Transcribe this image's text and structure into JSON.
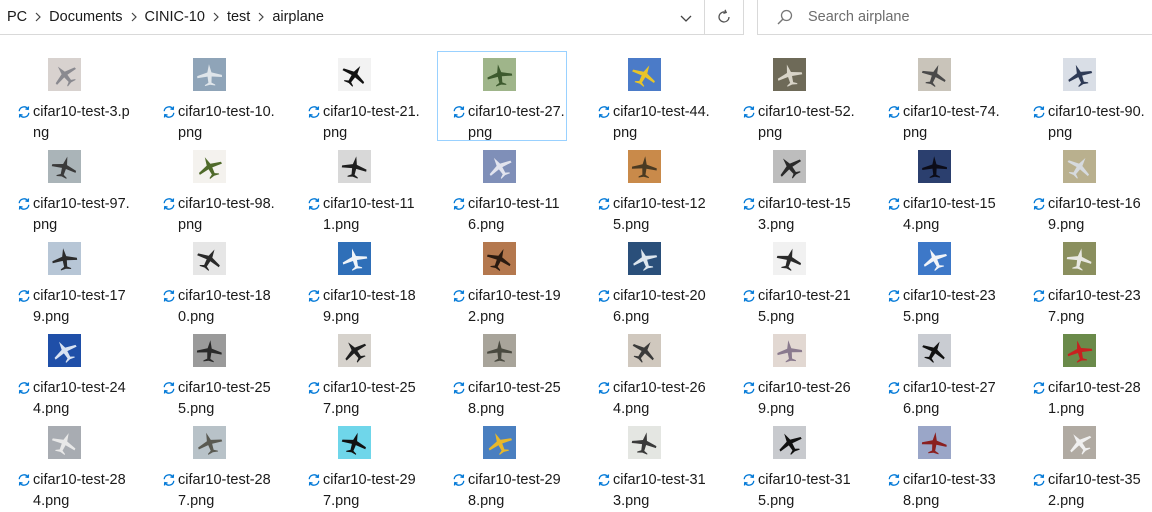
{
  "breadcrumb": [
    "PC",
    "Documents",
    "CINIC-10",
    "test",
    "airplane"
  ],
  "search": {
    "placeholder": "Search airplane"
  },
  "colors": {
    "accent": "#0078d7",
    "selection_border": "#99d1ff",
    "border": "#d9d9d9"
  },
  "files": [
    {
      "line1": "cifar10-test-3.p",
      "line2": "ng",
      "bg": "#d8d2cf",
      "fg": "#8a8a90",
      "selected": false
    },
    {
      "line1": "cifar10-test-10.",
      "line2": "png",
      "bg": "#8fa4b8",
      "fg": "#dfe5ea",
      "selected": false
    },
    {
      "line1": "cifar10-test-21.",
      "line2": "png",
      "bg": "#f2f2f2",
      "fg": "#111111",
      "selected": false
    },
    {
      "line1": "cifar10-test-27.",
      "line2": "png",
      "bg": "#9fb58a",
      "fg": "#3d5a2e",
      "selected": true
    },
    {
      "line1": "cifar10-test-44.",
      "line2": "png",
      "bg": "#4b7bc8",
      "fg": "#e8c428",
      "selected": false
    },
    {
      "line1": "cifar10-test-52.",
      "line2": "png",
      "bg": "#6e6a58",
      "fg": "#d8d4c8",
      "selected": false
    },
    {
      "line1": "cifar10-test-74.",
      "line2": "png",
      "bg": "#c9c4ba",
      "fg": "#4a4a4a",
      "selected": false
    },
    {
      "line1": "cifar10-test-90.",
      "line2": "png",
      "bg": "#d9dee6",
      "fg": "#2e3a55",
      "selected": false
    },
    {
      "line1": "cifar10-test-97.",
      "line2": "png",
      "bg": "#aab4b8",
      "fg": "#3a3a3a",
      "selected": false
    },
    {
      "line1": "cifar10-test-98.",
      "line2": "png",
      "bg": "#f4f2ee",
      "fg": "#4f6a2a",
      "selected": false
    },
    {
      "line1": "cifar10-test-11",
      "line2": "1.png",
      "bg": "#d8d8d8",
      "fg": "#1e1e1e",
      "selected": false
    },
    {
      "line1": "cifar10-test-11",
      "line2": "6.png",
      "bg": "#7f8fb8",
      "fg": "#e2e4ee",
      "selected": false
    },
    {
      "line1": "cifar10-test-12",
      "line2": "5.png",
      "bg": "#c98a4a",
      "fg": "#4a3a22",
      "selected": false
    },
    {
      "line1": "cifar10-test-15",
      "line2": "3.png",
      "bg": "#bdbdbd",
      "fg": "#2a2a2a",
      "selected": false
    },
    {
      "line1": "cifar10-test-15",
      "line2": "4.png",
      "bg": "#2b3f6e",
      "fg": "#0c0c18",
      "selected": false
    },
    {
      "line1": "cifar10-test-16",
      "line2": "9.png",
      "bg": "#b9b08e",
      "fg": "#d6dade",
      "selected": false
    },
    {
      "line1": "cifar10-test-17",
      "line2": "9.png",
      "bg": "#b7c6d6",
      "fg": "#2c2c2c",
      "selected": false
    },
    {
      "line1": "cifar10-test-18",
      "line2": "0.png",
      "bg": "#e6e6e6",
      "fg": "#2a2a2a",
      "selected": false
    },
    {
      "line1": "cifar10-test-18",
      "line2": "9.png",
      "bg": "#2f6fb8",
      "fg": "#f0f4f8",
      "selected": false
    },
    {
      "line1": "cifar10-test-19",
      "line2": "2.png",
      "bg": "#b4784e",
      "fg": "#2a1a10",
      "selected": false
    },
    {
      "line1": "cifar10-test-20",
      "line2": "6.png",
      "bg": "#2a4f7a",
      "fg": "#dde6ee",
      "selected": false
    },
    {
      "line1": "cifar10-test-21",
      "line2": "5.png",
      "bg": "#f1f1f1",
      "fg": "#2a2a2a",
      "selected": false
    },
    {
      "line1": "cifar10-test-23",
      "line2": "5.png",
      "bg": "#3d78c8",
      "fg": "#f2f4f8",
      "selected": false
    },
    {
      "line1": "cifar10-test-23",
      "line2": "7.png",
      "bg": "#8a8f5e",
      "fg": "#e8e8e2",
      "selected": false
    },
    {
      "line1": "cifar10-test-24",
      "line2": "4.png",
      "bg": "#1f4fa8",
      "fg": "#d8e2f2",
      "selected": false
    },
    {
      "line1": "cifar10-test-25",
      "line2": "5.png",
      "bg": "#9a9a9a",
      "fg": "#2a2a2a",
      "selected": false
    },
    {
      "line1": "cifar10-test-25",
      "line2": "7.png",
      "bg": "#d6d2cc",
      "fg": "#1e1e1e",
      "selected": false
    },
    {
      "line1": "cifar10-test-25",
      "line2": "8.png",
      "bg": "#a8a49a",
      "fg": "#4a4a40",
      "selected": false
    },
    {
      "line1": "cifar10-test-26",
      "line2": "4.png",
      "bg": "#d0c8be",
      "fg": "#3a3a3a",
      "selected": false
    },
    {
      "line1": "cifar10-test-26",
      "line2": "9.png",
      "bg": "#e2d8d2",
      "fg": "#8a7a8e",
      "selected": false
    },
    {
      "line1": "cifar10-test-27",
      "line2": "6.png",
      "bg": "#c9ccd2",
      "fg": "#111111",
      "selected": false
    },
    {
      "line1": "cifar10-test-28",
      "line2": "1.png",
      "bg": "#6a8a4a",
      "fg": "#c82020",
      "selected": false
    },
    {
      "line1": "cifar10-test-28",
      "line2": "4.png",
      "bg": "#a8acb2",
      "fg": "#e8e8e8",
      "selected": false
    },
    {
      "line1": "cifar10-test-28",
      "line2": "7.png",
      "bg": "#b8c2c8",
      "fg": "#5a5a52",
      "selected": false
    },
    {
      "line1": "cifar10-test-29",
      "line2": "7.png",
      "bg": "#6fd6ea",
      "fg": "#111111",
      "selected": false
    },
    {
      "line1": "cifar10-test-29",
      "line2": "8.png",
      "bg": "#4a7fc0",
      "fg": "#e8b82a",
      "selected": false
    },
    {
      "line1": "cifar10-test-31",
      "line2": "3.png",
      "bg": "#e4e6e2",
      "fg": "#3a3a3a",
      "selected": false
    },
    {
      "line1": "cifar10-test-31",
      "line2": "5.png",
      "bg": "#c8cace",
      "fg": "#111111",
      "selected": false
    },
    {
      "line1": "cifar10-test-33",
      "line2": "8.png",
      "bg": "#9aa6c8",
      "fg": "#8a2020",
      "selected": false
    },
    {
      "line1": "cifar10-test-35",
      "line2": "2.png",
      "bg": "#b0aaa2",
      "fg": "#f0f0f0",
      "selected": false
    }
  ]
}
